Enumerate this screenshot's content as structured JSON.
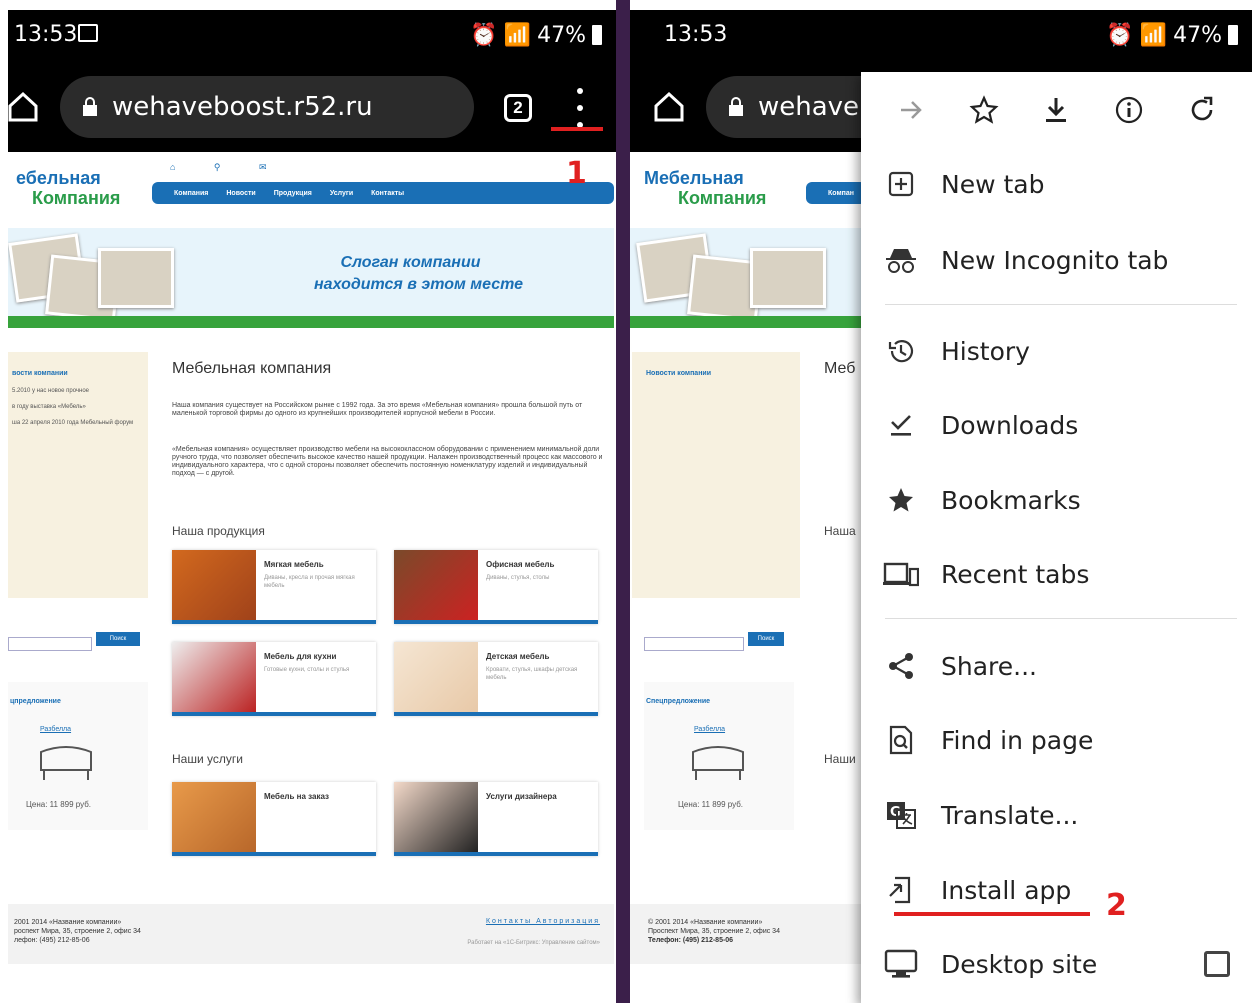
{
  "left": {
    "status": {
      "time": "13:53",
      "battery": "47%"
    },
    "url": "wehaveboost.r52.ru",
    "tab_count": "2",
    "annotation_number": "1",
    "site": {
      "logo_line1": "ебельная",
      "logo_line2": "Компания",
      "nav": [
        "Компания",
        "Новости",
        "Продукция",
        "Услуги",
        "Контакты"
      ],
      "slogan_line1": "Слоган компании",
      "slogan_line2": "находится в этом месте",
      "news_heading": "вости компании",
      "news_items": [
        "5.2010 у нас новое прочное",
        "в году выставка «Мебель»",
        "ша 22 апреля 2010 года Мебельный форум"
      ],
      "search_button": "Поиск",
      "special_heading": "цпредложение",
      "special_link": "Разбелла",
      "special_price": "Цена: 11 899 руб.",
      "main_title": "Мебельная компания",
      "para1": "Наша компания существует на Российском рынке с 1992 года. За это время «Мебельная компания» прошла большой путь от маленькой торговой фирмы до одного из крупнейших производителей корпусной мебели в России.",
      "para2": "«Мебельная компания» осуществляет производство мебели на высококлассном оборудовании с применением минимальной доли ручного труда, что позволяет обеспечить высокое качество нашей продукции. Налажен производственный процесс как массового и индивидуального характера, что с одной стороны позволяет обеспечить постоянную номенклатуру изделий и индивидуальный подход — с другой.",
      "products_heading": "Наша продукция",
      "products": [
        {
          "title": "Мягкая мебель",
          "sub": "Диваны, кресла и прочая мягкая мебель"
        },
        {
          "title": "Офисная мебель",
          "sub": "Диваны, стулья, столы"
        },
        {
          "title": "Мебель для кухни",
          "sub": "Готовые кухни, столы и стулья"
        },
        {
          "title": "Детская мебель",
          "sub": "Кровати, стулья, шкафы детская мебель"
        }
      ],
      "services_heading": "Наши услуги",
      "services": [
        {
          "title": "Мебель на заказ"
        },
        {
          "title": "Услуги дизайнера"
        }
      ],
      "footer_l1": "2001 2014 «Название компании»",
      "footer_l2": "роспект Мира, 35, строение 2, офис 34",
      "footer_l3": "лефон: (495) 212-85-06",
      "footer_links": "Контакты  Авторизация",
      "footer_credit": "Работает на «1С-Битрикс: Управление сайтом»"
    }
  },
  "right": {
    "status": {
      "time": "13:53",
      "battery": "47%"
    },
    "url_partial": "wehaveb",
    "menu_icons": [
      "forward-icon",
      "star-icon",
      "download-icon",
      "info-icon",
      "refresh-icon"
    ],
    "menu_items": [
      {
        "id": "new-tab",
        "label": "New tab"
      },
      {
        "id": "new-incognito-tab",
        "label": "New Incognito tab"
      },
      {
        "id": "history",
        "label": "History"
      },
      {
        "id": "downloads",
        "label": "Downloads"
      },
      {
        "id": "bookmarks",
        "label": "Bookmarks"
      },
      {
        "id": "recent-tabs",
        "label": "Recent tabs"
      },
      {
        "id": "share",
        "label": "Share..."
      },
      {
        "id": "find-in-page",
        "label": "Find in page"
      },
      {
        "id": "translate",
        "label": "Translate..."
      },
      {
        "id": "install-app",
        "label": "Install app"
      },
      {
        "id": "desktop-site",
        "label": "Desktop site"
      }
    ],
    "annotation_number": "2",
    "site": {
      "logo_line1": "Мебельная",
      "logo_line2": "Компания",
      "nav_first": "Компан",
      "news_heading": "Новости компании",
      "special_heading": "Спецпредложение",
      "special_link": "Разбелла",
      "special_price": "Цена: 11 899 руб.",
      "search_button": "Поиск",
      "main_title_partial": "Меб",
      "products_partial": "Наша",
      "services_partial": "Наши",
      "footer_l1": "© 2001 2014 «Название компании»",
      "footer_l2": "Проспект Мира, 35, строение 2, офис 34",
      "footer_l3": "Телефон: (495) 212-85-06"
    }
  },
  "colors": {
    "accent_blue": "#1a6fb5",
    "green": "#37a33c",
    "annotation_red": "#e02020",
    "divider": "#3b1f4a"
  }
}
